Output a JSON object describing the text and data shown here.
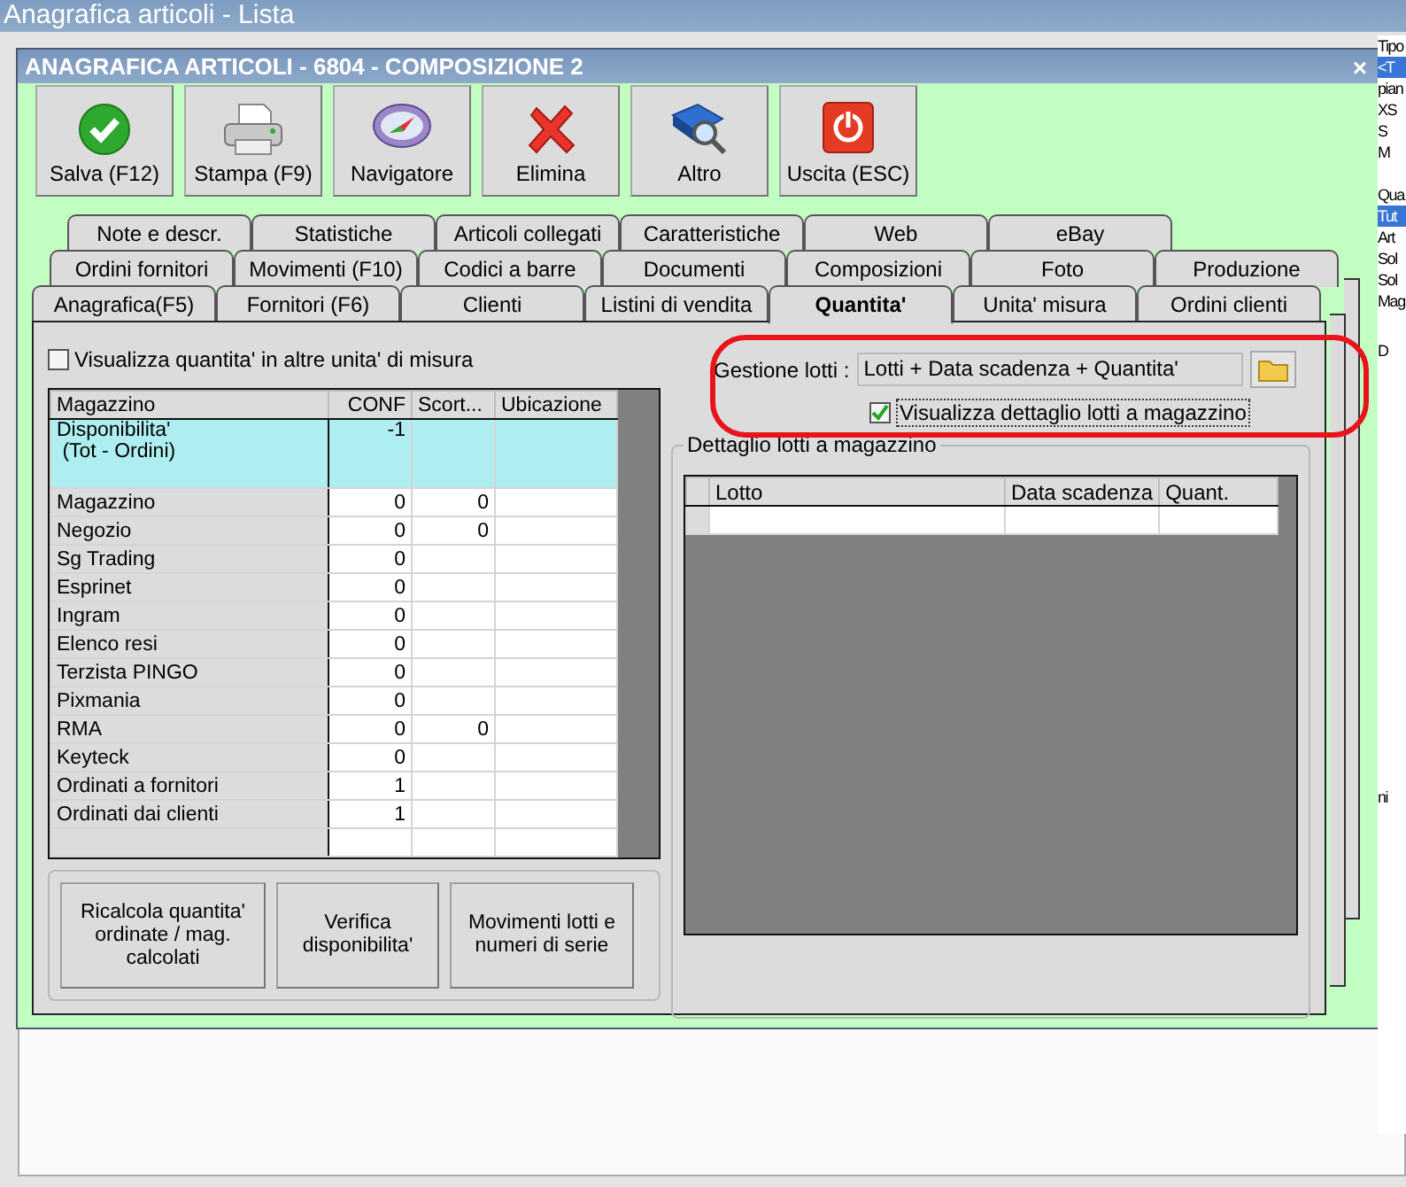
{
  "background_window": {
    "title": "Anagrafica articoli  - Lista",
    "side_header": "Tipo",
    "side_list_1": [
      {
        "label": "<T",
        "selected": true
      },
      {
        "label": "pian",
        "selected": false
      },
      {
        "label": "XS",
        "selected": false
      },
      {
        "label": "S",
        "selected": false
      },
      {
        "label": "M",
        "selected": false
      }
    ],
    "side_label": "Qua",
    "side_list_2": [
      {
        "label": "Tut",
        "selected": true
      },
      {
        "label": "Art",
        "selected": false
      },
      {
        "label": "Sol",
        "selected": false
      },
      {
        "label": "Sol",
        "selected": false
      },
      {
        "label": "Mag",
        "selected": false
      }
    ],
    "side_column": "D",
    "side_tail": "ni"
  },
  "dialog": {
    "title": "ANAGRAFICA ARTICOLI - 6804 - COMPOSIZIONE 2",
    "close": "×",
    "toolbar": [
      {
        "label": "Salva (F12)",
        "kind": "save"
      },
      {
        "label": "Stampa (F9)",
        "kind": "print"
      },
      {
        "label": "Navigatore",
        "kind": "navigator"
      },
      {
        "label": "Elimina",
        "kind": "delete"
      },
      {
        "label": "Altro",
        "kind": "more"
      },
      {
        "label": "Uscita (ESC)",
        "kind": "exit"
      }
    ],
    "tab_rows": [
      [
        {
          "label": "Note e descr.",
          "selected": false
        },
        {
          "label": "Statistiche",
          "selected": false
        },
        {
          "label": "Articoli collegati",
          "selected": false
        },
        {
          "label": "Caratteristiche",
          "selected": false
        },
        {
          "label": "Web",
          "selected": false
        },
        {
          "label": "eBay",
          "selected": false
        }
      ],
      [
        {
          "label": "Ordini fornitori",
          "selected": false
        },
        {
          "label": "Movimenti (F10)",
          "selected": false
        },
        {
          "label": "Codici a barre",
          "selected": false
        },
        {
          "label": "Documenti",
          "selected": false
        },
        {
          "label": "Composizioni",
          "selected": false
        },
        {
          "label": "Foto",
          "selected": false
        },
        {
          "label": "Produzione",
          "selected": false
        }
      ],
      [
        {
          "label": "Anagrafica(F5)",
          "selected": false
        },
        {
          "label": "Fornitori (F6)",
          "selected": false
        },
        {
          "label": "Clienti",
          "selected": false
        },
        {
          "label": "Listini di vendita",
          "selected": false
        },
        {
          "label": "Quantita'",
          "selected": true
        },
        {
          "label": "Unita' misura",
          "selected": false
        },
        {
          "label": "Ordini clienti",
          "selected": false
        }
      ]
    ],
    "other_units_checkbox": {
      "label": "Visualizza quantita' in altre unita' di misura",
      "checked": false
    },
    "stock_grid": {
      "columns": [
        "Magazzino",
        "CONF",
        "Scort...",
        "Ubicazione"
      ],
      "rows": [
        {
          "name": "Disponibilita'\n (Tot - Ordini)",
          "conf": "-1",
          "selected": true
        },
        {
          "name": "Magazzino",
          "conf": "0",
          "scorta": "0",
          "selected": false
        },
        {
          "name": "Negozio",
          "conf": "0",
          "scorta": "0",
          "selected": false
        },
        {
          "name": "Sg Trading",
          "conf": "0",
          "selected": false
        },
        {
          "name": "Esprinet",
          "conf": "0",
          "selected": false
        },
        {
          "name": "Ingram",
          "conf": "0",
          "selected": false
        },
        {
          "name": "Elenco resi",
          "conf": "0",
          "selected": false
        },
        {
          "name": "Terzista PINGO",
          "conf": "0",
          "selected": false
        },
        {
          "name": "Pixmania",
          "conf": "0",
          "selected": false
        },
        {
          "name": "RMA",
          "conf": "0",
          "scorta": "0",
          "selected": false
        },
        {
          "name": "Keyteck",
          "conf": "0",
          "selected": false
        },
        {
          "name": "Ordinati a fornitori",
          "conf": "1",
          "selected": false
        },
        {
          "name": "Ordinati dai clienti",
          "conf": "1",
          "selected": false
        }
      ]
    },
    "action_buttons": [
      "Ricalcola quantita'\nordinate / mag.\ncalcolati",
      "Verifica\ndisponibilita'",
      "Movimenti lotti e\nnumeri di serie"
    ],
    "lot_management": {
      "label": "Gestione lotti :",
      "value": "Lotti + Data scadenza + Quantita'"
    },
    "lot_detail_checkbox": {
      "label": "Visualizza dettaglio lotti a magazzino",
      "checked": true
    },
    "lot_detail": {
      "title": "Dettaglio lotti a magazzino",
      "columns": [
        "Lotto",
        "Data scadenza",
        "Quant."
      ]
    }
  }
}
